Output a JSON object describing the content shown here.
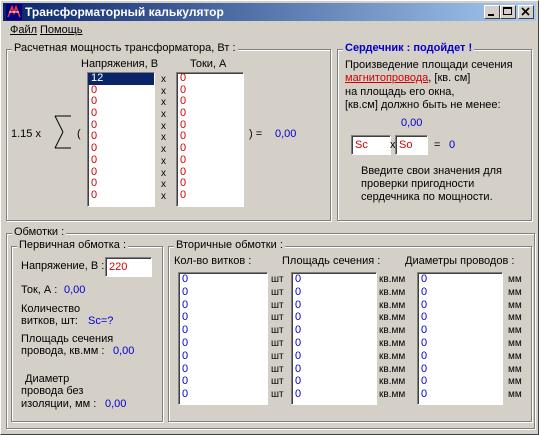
{
  "window": {
    "title": "Трансформаторный калькулятор"
  },
  "menu": {
    "file": "Файл",
    "help": "Помощь"
  },
  "power": {
    "legend": "Расчетная мощность трансформатора, Вт :",
    "col_voltage": "Напряжения, В",
    "col_current": "Токи, А",
    "factor": "1.15  x",
    "open_paren": "(",
    "close_eq": ") =",
    "result": "0,00",
    "voltages": [
      "12",
      "0",
      "0",
      "0",
      "0",
      "0",
      "0",
      "0",
      "0",
      "0",
      "0"
    ],
    "currents": [
      "0",
      "0",
      "0",
      "0",
      "0",
      "0",
      "0",
      "0",
      "0",
      "0",
      "0"
    ],
    "x_marks": [
      "x",
      "x",
      "x",
      "x",
      "x",
      "x",
      "x",
      "x",
      "x",
      "x",
      "x"
    ]
  },
  "core": {
    "status": "Сердечник : подойдет !",
    "line1": "Произведение площади сечения",
    "link": "магнитопровода",
    "line2_rest": ", [кв. см]",
    "line3": "на площадь его окна,",
    "line4": "[кв.см] должно быть не менее:",
    "min_value": "0,00",
    "sc": "Sc",
    "x": "x",
    "so": "So",
    "eq": "=",
    "product": "0",
    "hint1": "Введите свои значения для",
    "hint2": "проверки пригодности",
    "hint3": "сердечника по мощности."
  },
  "windings": {
    "legend": "Обмотки :",
    "primary": {
      "legend": "Первичная обмотка :",
      "voltage_label": "Напряжение, В :",
      "voltage_value": "220",
      "current_label": "Ток, А :",
      "current_value": "0,00",
      "turns_label1": "Количество",
      "turns_label2": "витков, шт:",
      "turns_value": "Sc=?",
      "area_label1": "Площадь сечения",
      "area_label2": "провода, кв.мм :",
      "area_value": "0,00",
      "diam_label1": "Диаметр",
      "diam_label2": "провода без",
      "diam_label3": "изоляции, мм :",
      "diam_value": "0,00"
    },
    "secondary": {
      "legend": "Вторичные обмотки :",
      "col_turns": "Кол-во витков :",
      "col_area": "Площадь сечения :",
      "col_diam": "Диаметры проводов :",
      "turns": [
        "0",
        "0",
        "0",
        "0",
        "0",
        "0",
        "0",
        "0",
        "0",
        "0"
      ],
      "areas": [
        "0",
        "0",
        "0",
        "0",
        "0",
        "0",
        "0",
        "0",
        "0",
        "0"
      ],
      "diams": [
        "0",
        "0",
        "0",
        "0",
        "0",
        "0",
        "0",
        "0",
        "0",
        "0"
      ],
      "unit_pcs": [
        "шт",
        "шт",
        "шт",
        "шт",
        "шт",
        "шт",
        "шт",
        "шт",
        "шт",
        "шт"
      ],
      "unit_area": [
        "кв.мм",
        "кв.мм",
        "кв.мм",
        "кв.мм",
        "кв.мм",
        "кв.мм",
        "кв.мм",
        "кв.мм",
        "кв.мм",
        "кв.мм"
      ],
      "unit_mm": [
        "мм",
        "мм",
        "мм",
        "мм",
        "мм",
        "мм",
        "мм",
        "мм",
        "мм",
        "мм"
      ]
    }
  }
}
